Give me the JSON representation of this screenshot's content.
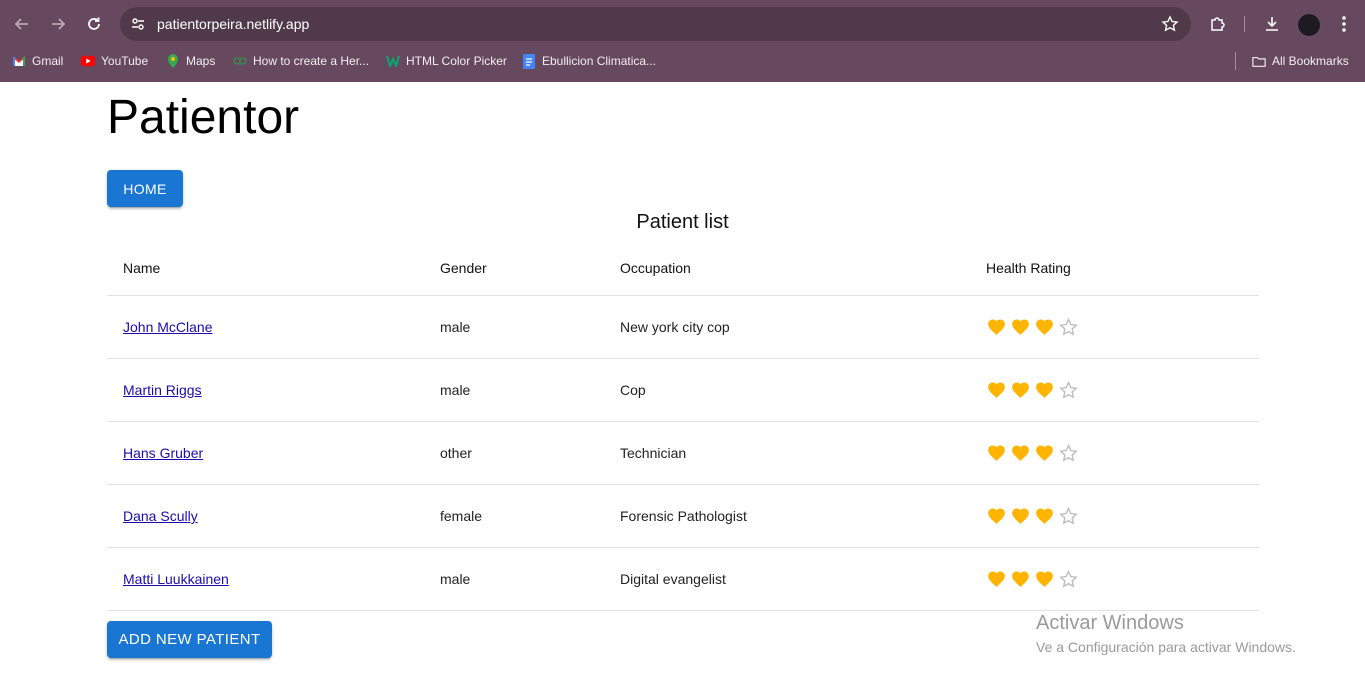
{
  "browser": {
    "url": "patientorpeira.netlify.app",
    "bookmarks": [
      {
        "label": "Gmail",
        "icon": "gmail-icon"
      },
      {
        "label": "YouTube",
        "icon": "youtube-icon"
      },
      {
        "label": "Maps",
        "icon": "maps-icon"
      },
      {
        "label": "How to create a Her...",
        "icon": "link-icon"
      },
      {
        "label": "HTML Color Picker",
        "icon": "w3schools-icon"
      },
      {
        "label": "Ebullicion Climatica...",
        "icon": "docs-icon"
      }
    ],
    "all_bookmarks": "All Bookmarks",
    "colors": {
      "frame": "#66495f",
      "omnibox": "#503a4a"
    }
  },
  "app": {
    "title": "Patientor",
    "home_button": "HOME",
    "list_title": "Patient list",
    "add_button": "ADD NEW PATIENT",
    "accent": "#1976d2"
  },
  "table": {
    "headers": {
      "name": "Name",
      "gender": "Gender",
      "occupation": "Occupation",
      "rating": "Health Rating"
    },
    "rows": [
      {
        "name": "John McClane",
        "gender": "male",
        "occupation": "New york city cop",
        "rating": 3,
        "max": 4
      },
      {
        "name": "Martin Riggs",
        "gender": "male",
        "occupation": "Cop",
        "rating": 3,
        "max": 4
      },
      {
        "name": "Hans Gruber",
        "gender": "other",
        "occupation": "Technician",
        "rating": 3,
        "max": 4
      },
      {
        "name": "Dana Scully",
        "gender": "female",
        "occupation": "Forensic Pathologist",
        "rating": 3,
        "max": 4
      },
      {
        "name": "Matti Luukkainen",
        "gender": "male",
        "occupation": "Digital evangelist",
        "rating": 3,
        "max": 4
      }
    ],
    "heart_color": "#ffb400"
  },
  "watermark": {
    "line1": "Activar Windows",
    "line2": "Ve a Configuración para activar Windows."
  }
}
